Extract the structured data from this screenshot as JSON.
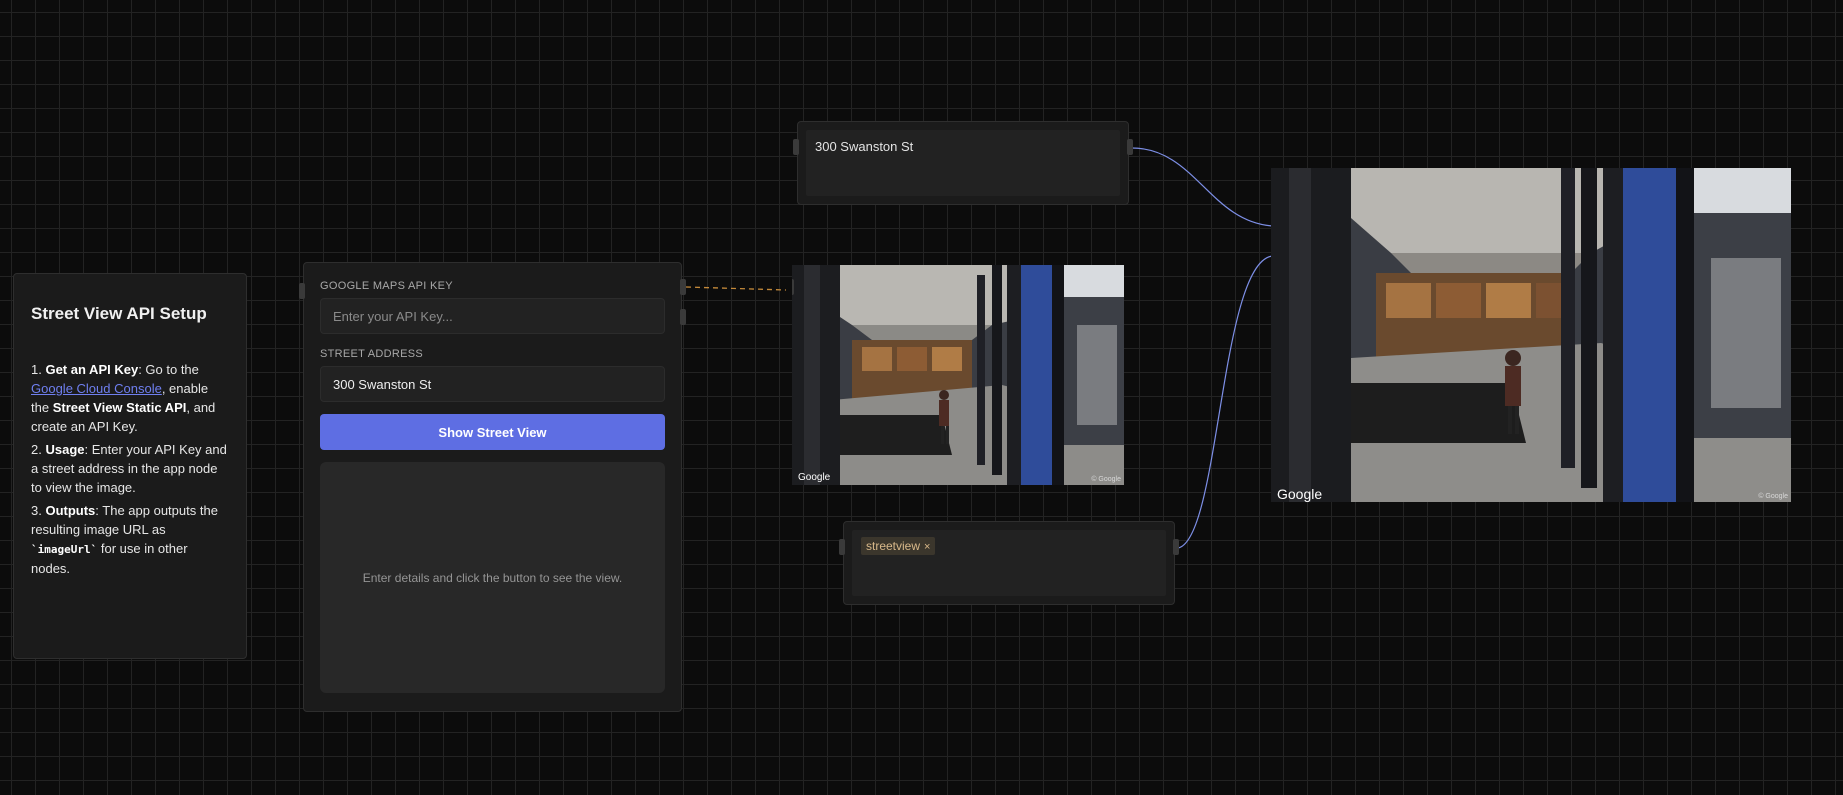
{
  "notes": {
    "title": "Street View API Setup",
    "step1_num": "1. ",
    "step1_bold": "Get an API Key",
    "step1_a": ": Go to the ",
    "step1_link": "Google Cloud Console",
    "step1_b": ", enable the ",
    "step1_bold2": "Street View Static API",
    "step1_c": ", and create an API Key.",
    "step2_num": "2. ",
    "step2_bold": "Usage",
    "step2_text": ": Enter your API Key and a street address in the app node to view the image.",
    "step3_num": "3. ",
    "step3_bold": "Outputs",
    "step3_text": ": The app outputs the resulting image URL as ",
    "step3_code": "`imageUrl`",
    "step3_tail": " for use in other nodes."
  },
  "app": {
    "api_key_label": "GOOGLE MAPS API KEY",
    "api_key_value": "",
    "api_key_placeholder": "Enter your API Key...",
    "address_label": "STREET ADDRESS",
    "address_value": "300 Swanston St",
    "button_label": "Show Street View",
    "view_placeholder": "Enter details and click the button to see the view."
  },
  "text_node": {
    "value": "300 Swanston St"
  },
  "small_image": {
    "logo": "Google",
    "copyright": "© Google"
  },
  "big_image": {
    "logo": "Google",
    "copyright": "© Google"
  },
  "tag_node": {
    "tags": [
      "streetview"
    ],
    "remove_symbol": "×"
  },
  "colors": {
    "accent_button": "#5e6ee3",
    "wire": "#7d8fe6",
    "wire_dashed": "#c58a3a",
    "link": "#6f7ff0",
    "tag_bg": "#3b362c",
    "tag_text": "#d9b98a"
  }
}
